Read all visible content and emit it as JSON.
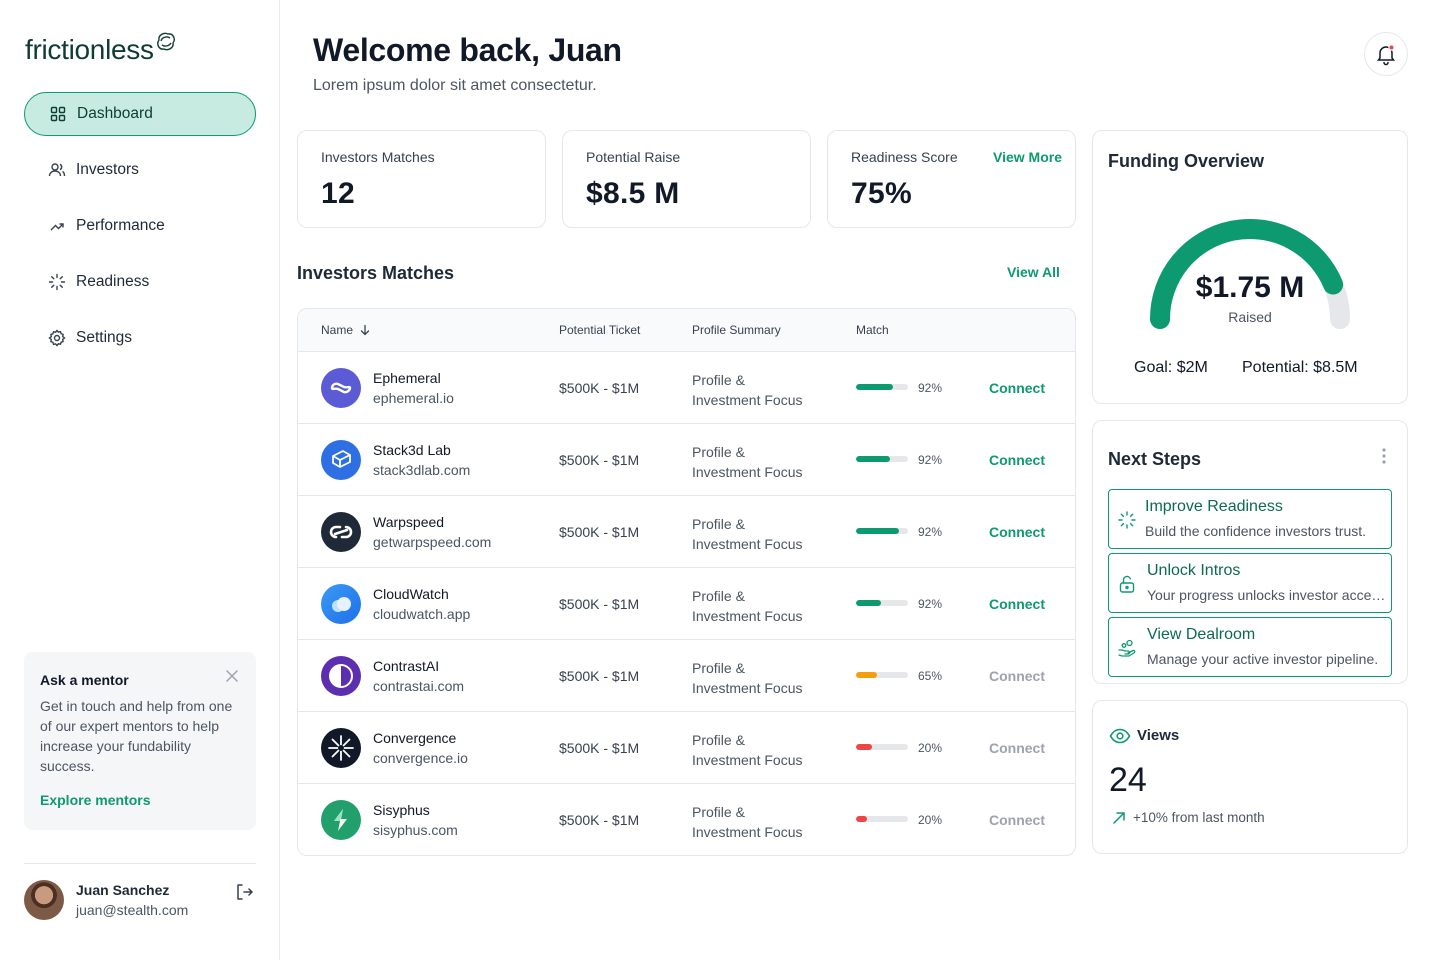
{
  "brand": {
    "name": "frictionless",
    "accent": "#0e9a70"
  },
  "sidebar": {
    "items": [
      {
        "label": "Dashboard",
        "icon": "grid-icon",
        "active": true
      },
      {
        "label": "Investors",
        "icon": "users-icon"
      },
      {
        "label": "Performance",
        "icon": "trending-up-icon"
      },
      {
        "label": "Readiness",
        "icon": "loader-icon"
      },
      {
        "label": "Settings",
        "icon": "gear-icon"
      }
    ],
    "mentor": {
      "title": "Ask a mentor",
      "body": "Get in touch and help from one of our expert mentors to help increase your fundability success.",
      "link": "Explore mentors"
    },
    "user": {
      "name": "Juan Sanchez",
      "email": "juan@stealth.com"
    }
  },
  "header": {
    "title": "Welcome back, Juan",
    "subtitle": "Lorem ipsum dolor sit amet consectetur."
  },
  "stats": [
    {
      "label": "Investors Matches",
      "value": "12"
    },
    {
      "label": "Potential Raise",
      "value": "$8.5 M"
    },
    {
      "label": "Readiness Score",
      "value": "75%",
      "link": "View More"
    }
  ],
  "matches": {
    "title": "Investors Matches",
    "view_all": "View All",
    "columns": {
      "name": "Name",
      "ticket": "Potential Ticket",
      "profile": "Profile Summary",
      "match": "Match"
    },
    "rows": [
      {
        "name": "Ephemeral",
        "url": "ephemeral.io",
        "ticket": "$500K - $1M",
        "profile1": "Profile &",
        "profile2": "Investment Focus",
        "match": "92%",
        "match_value": 0.72,
        "connect": "Connect",
        "connect_enabled": true,
        "bar_color": "#0e9a70"
      },
      {
        "name": "Stack3d Lab",
        "url": "stack3dlab.com",
        "ticket": "$500K - $1M",
        "profile1": "Profile &",
        "profile2": "Investment Focus",
        "match": "92%",
        "match_value": 0.65,
        "connect": "Connect",
        "connect_enabled": true,
        "bar_color": "#0e9a70"
      },
      {
        "name": "Warpspeed",
        "url": "getwarpspeed.com",
        "ticket": "$500K - $1M",
        "profile1": "Profile &",
        "profile2": "Investment Focus",
        "match": "92%",
        "match_value": 0.82,
        "connect": "Connect",
        "connect_enabled": true,
        "bar_color": "#0e9a70"
      },
      {
        "name": "CloudWatch",
        "url": "cloudwatch.app",
        "ticket": "$500K - $1M",
        "profile1": "Profile &",
        "profile2": "Investment Focus",
        "match": "92%",
        "match_value": 0.48,
        "connect": "Connect",
        "connect_enabled": true,
        "bar_color": "#0e9a70"
      },
      {
        "name": "ContrastAI",
        "url": "contrastai.com",
        "ticket": "$500K - $1M",
        "profile1": "Profile &",
        "profile2": "Investment Focus",
        "match": "65%",
        "match_value": 0.4,
        "connect": "Connect",
        "connect_enabled": false,
        "bar_color": "#f59e0b"
      },
      {
        "name": "Convergence",
        "url": "convergence.io",
        "ticket": "$500K - $1M",
        "profile1": "Profile &",
        "profile2": "Investment Focus",
        "match": "20%",
        "match_value": 0.3,
        "connect": "Connect",
        "connect_enabled": false,
        "bar_color": "#ef4444"
      },
      {
        "name": "Sisyphus",
        "url": "sisyphus.com",
        "ticket": "$500K - $1M",
        "profile1": "Profile &",
        "profile2": "Investment Focus",
        "match": "20%",
        "match_value": 0.22,
        "connect": "Connect",
        "connect_enabled": false,
        "bar_color": "#ef4444"
      }
    ]
  },
  "funding": {
    "title": "Funding Overview",
    "amount": "$1.75 M",
    "raised_label": "Raised",
    "goal": "Goal: $2M",
    "potential": "Potential: $8.5M",
    "progress": 0.875
  },
  "next_steps": {
    "title": "Next Steps",
    "items": [
      {
        "title": "Improve Readiness",
        "desc": "Build the confidence investors trust.",
        "icon": "loader-icon"
      },
      {
        "title": "Unlock Intros",
        "desc": "Your progress unlocks investor access.",
        "icon": "unlock-icon"
      },
      {
        "title": "View Dealroom",
        "desc": "Manage your active investor pipeline.",
        "icon": "hand-coins-icon"
      }
    ]
  },
  "views": {
    "label": "Views",
    "value": "24",
    "change": "+10% from last month"
  }
}
